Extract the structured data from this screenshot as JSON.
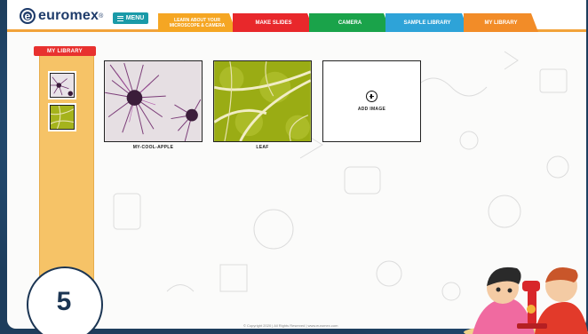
{
  "header": {
    "logo": "euromex",
    "menu_label": "MENU",
    "tabs": [
      {
        "label": "LEARN ABOUT YOUR MICROSCOPE & CAMERA",
        "color": "#f5a623"
      },
      {
        "label": "MAKE SLIDES",
        "color": "#e8282b"
      },
      {
        "label": "CAMERA",
        "color": "#1aa34a"
      },
      {
        "label": "SAMPLE LIBRARY",
        "color": "#2ea3d8"
      },
      {
        "label": "MY LIBRARY",
        "color": "#f28c28"
      }
    ]
  },
  "sidebar": {
    "title": "MY LIBRARY",
    "thumbnails": [
      {
        "name": "my-cool-apple"
      },
      {
        "name": "leaf"
      }
    ]
  },
  "library": {
    "images": [
      {
        "label": "MY-COOL-APPLE"
      },
      {
        "label": "LEAF"
      }
    ],
    "add_label": "ADD IMAGE"
  },
  "footer": {
    "text": "© Copyright 2020  |  All Rights Reserved  |  www.euromex.com"
  },
  "step_badge": "5",
  "colors": {
    "accent_orange": "#f2a33a",
    "sidebar": "#f6c367",
    "menu": "#1a9aa8",
    "badge": "#1b3553"
  }
}
